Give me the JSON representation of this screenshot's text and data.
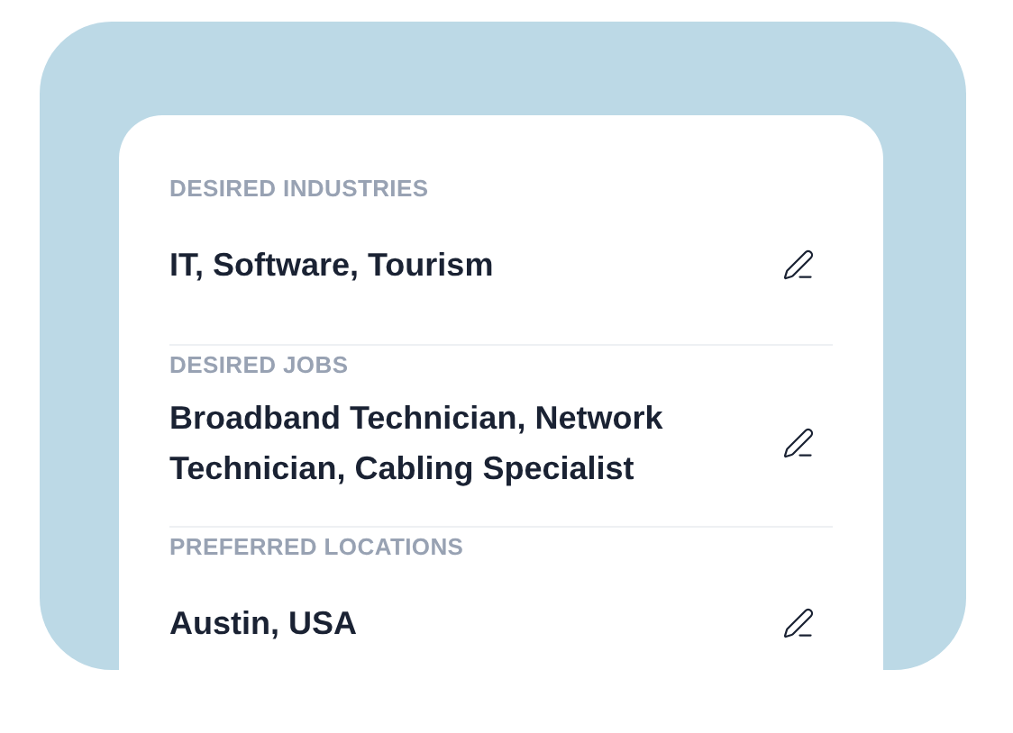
{
  "sections": [
    {
      "label": "DESIRED INDUSTRIES",
      "value": "IT, Software, Tourism"
    },
    {
      "label": "DESIRED JOBS",
      "value": "Broadband Technician, Network Technician, Cabling Specialist"
    },
    {
      "label": "PREFERRED LOCATIONS",
      "value": "Austin, USA"
    }
  ]
}
